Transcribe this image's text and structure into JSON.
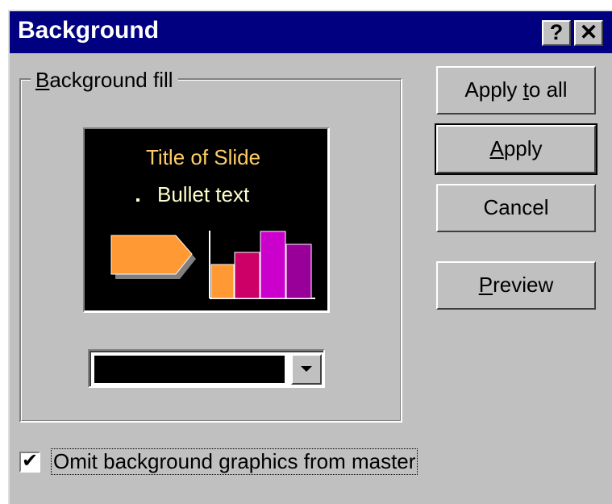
{
  "window": {
    "title": "Background",
    "help_label": "?",
    "close_label": "✕"
  },
  "group": {
    "label_mnemonic": "B",
    "label_rest": "ackground fill"
  },
  "preview": {
    "slide_title": "Title of Slide",
    "bullet_text": "Bullet text",
    "background_color": "#000000",
    "title_color": "#ffcc66",
    "text_color": "#ffffcc",
    "shape_color": "#ff9933",
    "bar_colors": [
      "#ff9933",
      "#cc0066",
      "#cc00cc",
      "#990099"
    ]
  },
  "fill_combo": {
    "selected_color": "#000000",
    "arrow_icon": "chevron-down-icon"
  },
  "buttons": {
    "apply_all_pre": "Apply ",
    "apply_all_mnemonic": "t",
    "apply_all_post": "o all",
    "apply_mnemonic": "A",
    "apply_post": "pply",
    "cancel": "Cancel",
    "preview_mnemonic": "P",
    "preview_post": "review"
  },
  "omit_checkbox": {
    "checked": true,
    "check_glyph": "✔",
    "label_pre": "Omit background ",
    "label_mnemonic": "g",
    "label_post": "raphics from master"
  }
}
